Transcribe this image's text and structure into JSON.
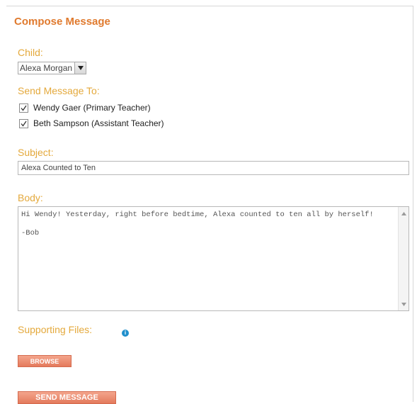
{
  "page": {
    "title": "Compose Message"
  },
  "child": {
    "label": "Child:",
    "selected": "Alexa Morgan"
  },
  "send_to": {
    "label": "Send Message To:",
    "recipients": [
      {
        "name": "Wendy Gaer (Primary Teacher)",
        "checked": true
      },
      {
        "name": "Beth Sampson (Assistant Teacher)",
        "checked": true
      }
    ]
  },
  "subject": {
    "label": "Subject:",
    "value": "Alexa Counted to Ten"
  },
  "body": {
    "label": "Body:",
    "value": "Hi Wendy! Yesterday, right before bedtime, Alexa counted to ten all by herself!\n\n-Bob"
  },
  "files": {
    "label": "Supporting Files:",
    "browse_label": "Browse"
  },
  "actions": {
    "send_label": "Send Message"
  },
  "colors": {
    "title": "#e07a2e",
    "label": "#e4a93c",
    "button": "#e47a5c",
    "info": "#1f8fcc"
  },
  "icons": {
    "select_arrow": "chevron-down-icon",
    "checkbox": "check-icon",
    "info": "info-icon"
  }
}
